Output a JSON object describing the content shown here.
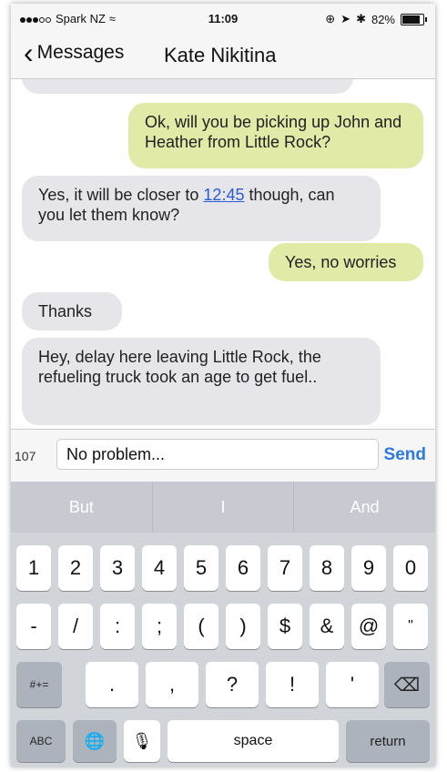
{
  "status": {
    "carrier": "Spark NZ",
    "wifi": "wifi-icon",
    "time": "11:09",
    "battery": "82%"
  },
  "nav": {
    "back_label": "Messages",
    "title": "Kate Nikitina"
  },
  "messages": [
    {
      "dir": "out",
      "text": "Ok, will you be picking up John and Heather from Little Rock?"
    },
    {
      "dir": "in",
      "before": "Yes, it will be closer to ",
      "link": "12:45",
      "after": " though, can you let them know?"
    },
    {
      "dir": "out",
      "text": "Yes, no worries"
    },
    {
      "dir": "in",
      "text": "Thanks"
    },
    {
      "dir": "in",
      "text": "Hey, delay here leaving Little Rock, the refueling truck took an age to get fuel.."
    }
  ],
  "composer": {
    "count": "107",
    "value": "No problem...",
    "send_label": "Send"
  },
  "predictions": [
    "But",
    "I",
    "And"
  ],
  "keyboard": {
    "row1": [
      "1",
      "2",
      "3",
      "4",
      "5",
      "6",
      "7",
      "8",
      "9",
      "0"
    ],
    "row2": [
      "-",
      "/",
      ":",
      ";",
      "(",
      ")",
      "$",
      "&",
      "@",
      "\""
    ],
    "row3": [
      ".",
      ",",
      "?",
      "!",
      "'"
    ],
    "symbols_label": "#+=",
    "abc_label": "ABC",
    "space_label": "space",
    "return_label": "return"
  }
}
